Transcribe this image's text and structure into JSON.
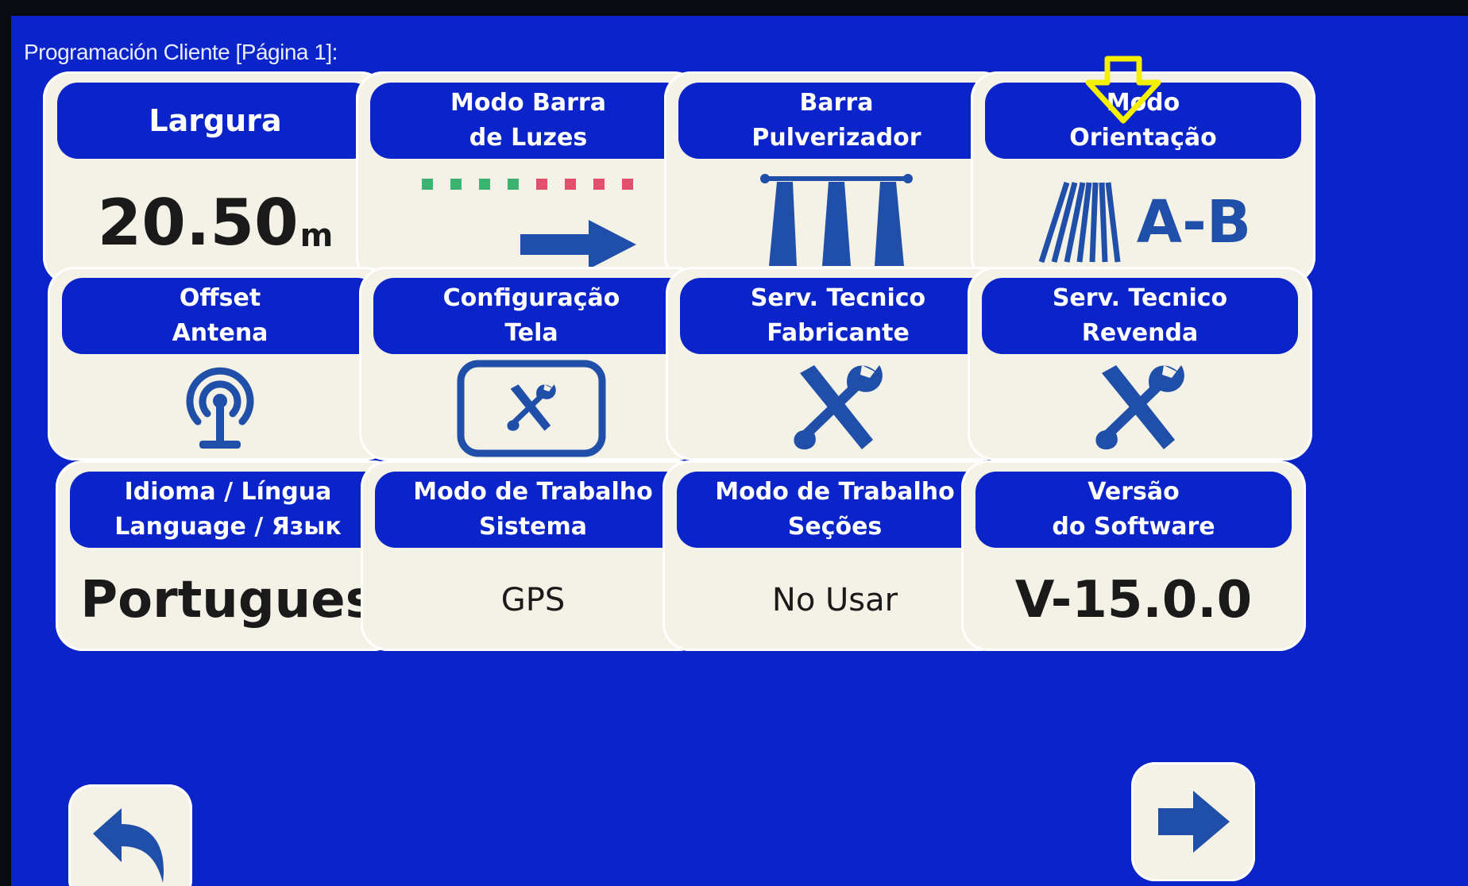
{
  "screen": {
    "title": "Programación Cliente [Página 1]:"
  },
  "tiles": {
    "largura": {
      "title": "Largura",
      "value": "20.50",
      "unit": "m"
    },
    "light_bar": {
      "line1": "Modo Barra",
      "line2": "de Luzes",
      "leds": [
        "green",
        "green",
        "green",
        "green",
        "red",
        "red",
        "red",
        "red"
      ]
    },
    "sprayer": {
      "line1": "Barra",
      "line2": "Pulverizador"
    },
    "guidance": {
      "line1": "Modo",
      "line2": "Orientação",
      "value": "A-B"
    },
    "antenna": {
      "line1": "Offset",
      "line2": "Antena"
    },
    "screen_cfg": {
      "line1": "Configuração",
      "line2": "Tela"
    },
    "tech_manufacturer": {
      "line1": "Serv. Tecnico",
      "line2": "Fabricante"
    },
    "tech_dealer": {
      "line1": "Serv. Tecnico",
      "line2": "Revenda"
    },
    "language": {
      "line1": "Idioma / Língua",
      "line2": "Language / Язык",
      "value": "Portugues"
    },
    "work_system": {
      "line1": "Modo de Trabalho",
      "line2": "Sistema",
      "value": "GPS"
    },
    "work_sections": {
      "line1": "Modo de Trabalho",
      "line2": "Seções",
      "value": "No Usar"
    },
    "software": {
      "line1": "Versão",
      "line2": "do Software",
      "value": "V-15.0.0"
    }
  },
  "icons": {
    "back": "back-arrow-icon",
    "next": "next-arrow-icon",
    "annotation": "yellow-down-arrow-icon"
  },
  "colors": {
    "screen_bg": "#0b24c9",
    "tile_bg": "#f4f1e6",
    "icon_blue": "#1f4fa8",
    "annotation": "#f5f000"
  }
}
